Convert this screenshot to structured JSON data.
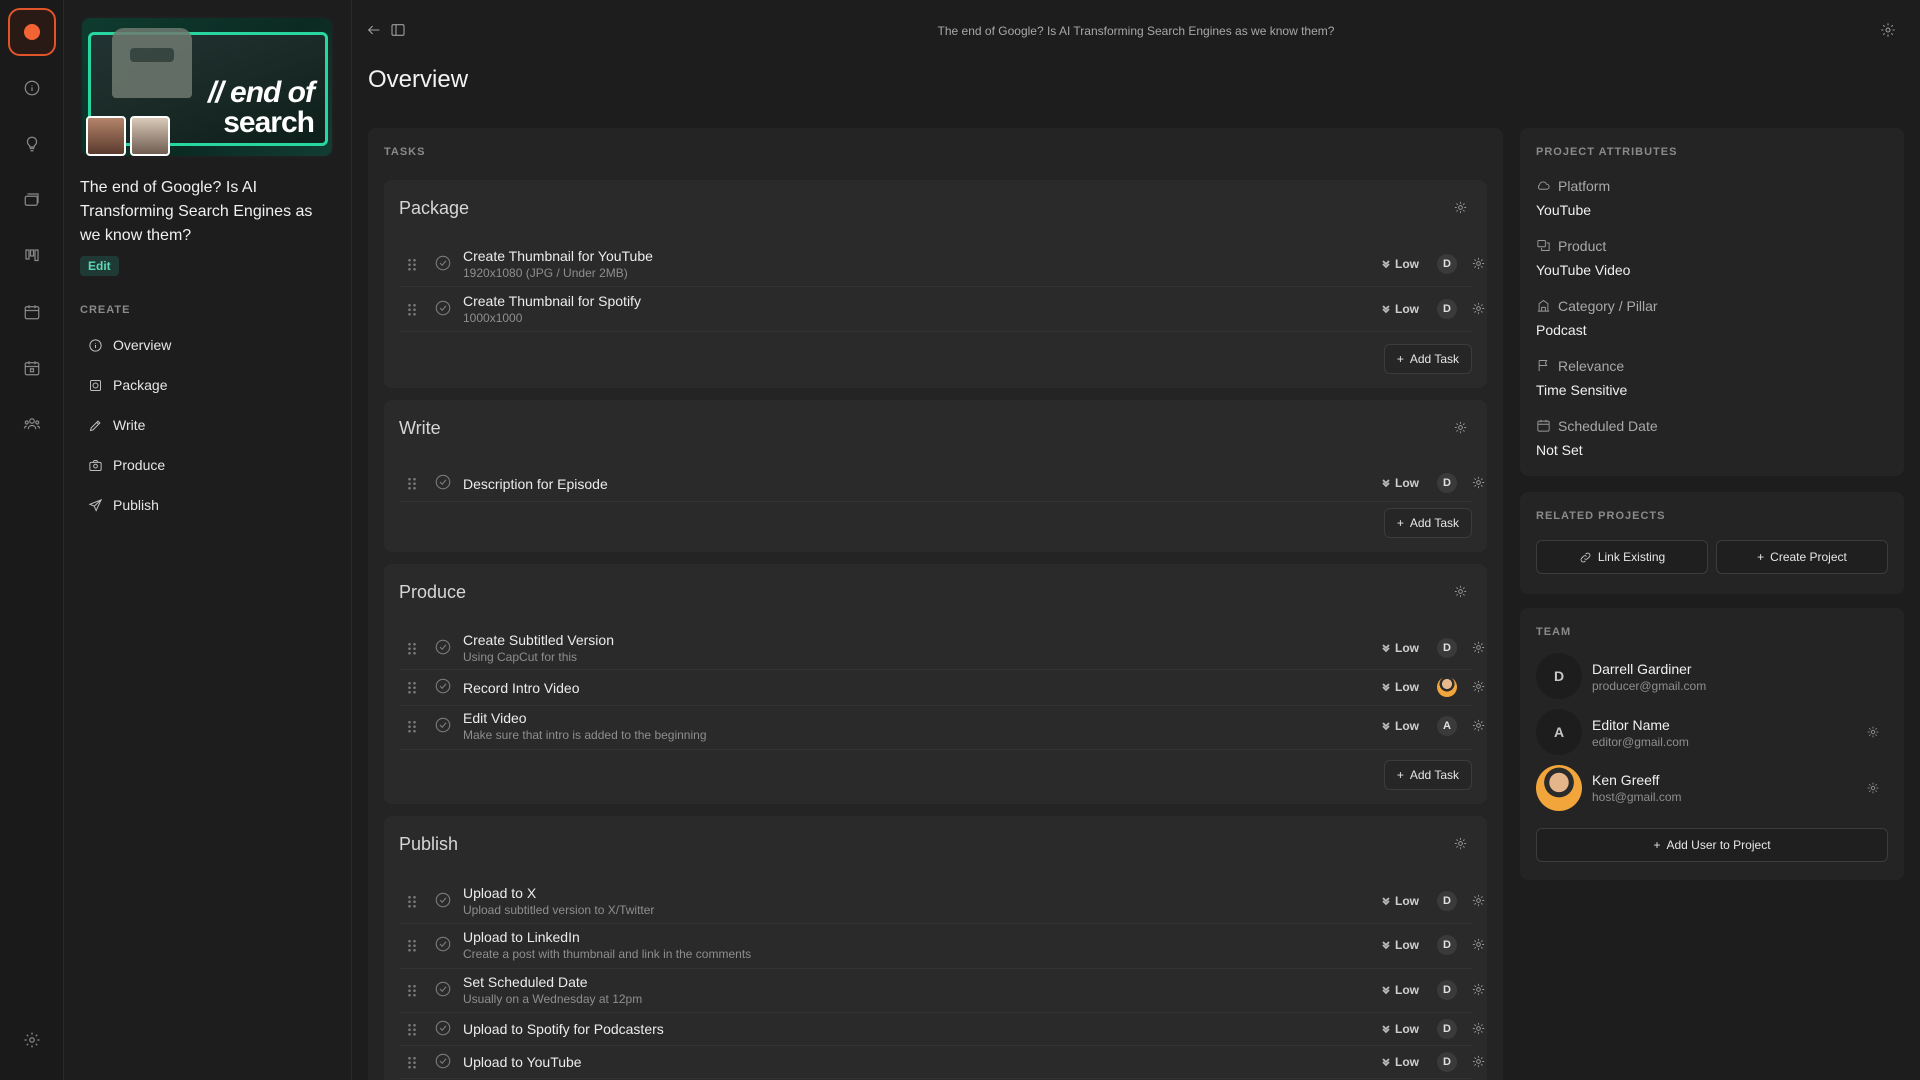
{
  "sidebar": {
    "thumbnail_line1": "// end of",
    "thumbnail_line2": "search",
    "project_title": "The end of Google? Is AI Transforming Search Engines as we know them?",
    "edit_label": "Edit",
    "section_label": "CREATE",
    "nav": [
      {
        "label": "Overview",
        "icon": "info-icon"
      },
      {
        "label": "Package",
        "icon": "package-icon"
      },
      {
        "label": "Write",
        "icon": "pen-icon"
      },
      {
        "label": "Produce",
        "icon": "camera-icon"
      },
      {
        "label": "Publish",
        "icon": "send-icon"
      }
    ]
  },
  "topbar": {
    "title": "The end of Google? Is AI Transforming Search Engines as we know them?"
  },
  "page": {
    "title": "Overview"
  },
  "tasks": {
    "label": "TASKS",
    "add_task_label": "Add Task",
    "groups": [
      {
        "title": "Package",
        "items": [
          {
            "name": "Create Thumbnail for YouTube",
            "sub": "1920x1080 (JPG / Under 2MB)",
            "priority": "Low",
            "assignee": "D"
          },
          {
            "name": "Create Thumbnail for Spotify",
            "sub": "1000x1000",
            "priority": "Low",
            "assignee": "D"
          }
        ]
      },
      {
        "title": "Write",
        "items": [
          {
            "name": "Description for Episode",
            "sub": "",
            "priority": "Low",
            "assignee": "D"
          }
        ]
      },
      {
        "title": "Produce",
        "items": [
          {
            "name": "Create Subtitled Version",
            "sub": "Using CapCut for this",
            "priority": "Low",
            "assignee": "D"
          },
          {
            "name": "Record Intro Video",
            "sub": "",
            "priority": "Low",
            "assignee": ""
          },
          {
            "name": "Edit Video",
            "sub": "Make sure that intro is added to the beginning",
            "priority": "Low",
            "assignee": "A"
          }
        ]
      },
      {
        "title": "Publish",
        "items": [
          {
            "name": "Upload to X",
            "sub": "Upload subtitled version to X/Twitter",
            "priority": "Low",
            "assignee": "D"
          },
          {
            "name": "Upload to LinkedIn",
            "sub": "Create a post with thumbnail and link in the comments",
            "priority": "Low",
            "assignee": "D"
          },
          {
            "name": "Set Scheduled Date",
            "sub": "Usually on a Wednesday at 12pm",
            "priority": "Low",
            "assignee": "D"
          },
          {
            "name": "Upload to Spotify for Podcasters",
            "sub": "",
            "priority": "Low",
            "assignee": "D"
          },
          {
            "name": "Upload to YouTube",
            "sub": "",
            "priority": "Low",
            "assignee": "D"
          }
        ]
      }
    ]
  },
  "attributes": {
    "label": "PROJECT ATTRIBUTES",
    "items": [
      {
        "label": "Platform",
        "value": "YouTube",
        "icon": "cloud-icon"
      },
      {
        "label": "Product",
        "value": "YouTube Video",
        "icon": "product-icon"
      },
      {
        "label": "Category / Pillar",
        "value": "Podcast",
        "icon": "building-icon"
      },
      {
        "label": "Relevance",
        "value": "Time Sensitive",
        "icon": "flag-icon"
      },
      {
        "label": "Scheduled Date",
        "value": "Not Set",
        "icon": "calendar-icon"
      }
    ]
  },
  "related": {
    "label": "RELATED PROJECTS",
    "link_existing": "Link Existing",
    "create_project": "Create Project"
  },
  "team": {
    "label": "TEAM",
    "members": [
      {
        "initial": "D",
        "name": "Darrell Gardiner",
        "email": "producer@gmail.com"
      },
      {
        "initial": "A",
        "name": "Editor Name",
        "email": "editor@gmail.com"
      },
      {
        "initial": "",
        "name": "Ken Greeff",
        "email": "host@gmail.com"
      }
    ],
    "add_user": "Add User to Project"
  }
}
